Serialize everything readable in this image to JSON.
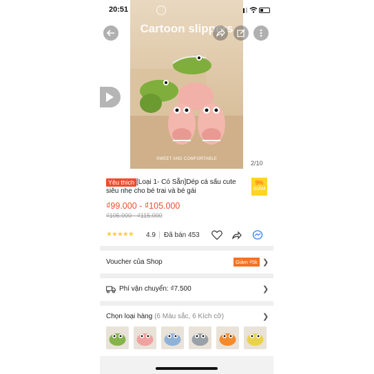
{
  "status_bar": {
    "time": "20:51",
    "location_glyph": "➶"
  },
  "hero": {
    "title": "Cartoon slippers",
    "caption": "SWEET AND COMFORTABLE",
    "pager": "2/10"
  },
  "product": {
    "favorite_badge": "Yêu thích",
    "title": "[Loại 1- Có Sẵn]Dép cá sấu cute siêu nhẹ cho bé trai và bé gái",
    "discount_percent": "9%",
    "discount_label": "GIẢM",
    "price": "₫99.000 - ₫105.000",
    "old_price": "₫105.000 - ₫115.000",
    "stars": "★★★★★",
    "rating": "4.9",
    "sold": "Đã bán 453"
  },
  "voucher": {
    "label": "Voucher của Shop",
    "tag": "Giảm ₫5k"
  },
  "shipping": {
    "label": "Phí vận chuyển: ₫7.500"
  },
  "variants": {
    "label": "Chọn loại hàng",
    "sub": "(6 Màu sắc, 6 Kích cỡ)",
    "thumb_colors": [
      "#86b34a",
      "#f0a2a0",
      "#8fb2d9",
      "#9aa0a8",
      "#f58a2b",
      "#e9d34a"
    ]
  },
  "colors": {
    "accent": "#ee4d2d",
    "star": "#ffce3d",
    "discount_bg": "#ffd424",
    "voucher_bg": "#f57224"
  },
  "icons": {
    "back": "arrow-left-icon",
    "share": "share-icon",
    "edit": "edit-icon",
    "more": "more-vertical-icon",
    "play": "play-icon",
    "heart": "heart-icon",
    "messenger": "messenger-icon",
    "truck": "truck-icon"
  }
}
